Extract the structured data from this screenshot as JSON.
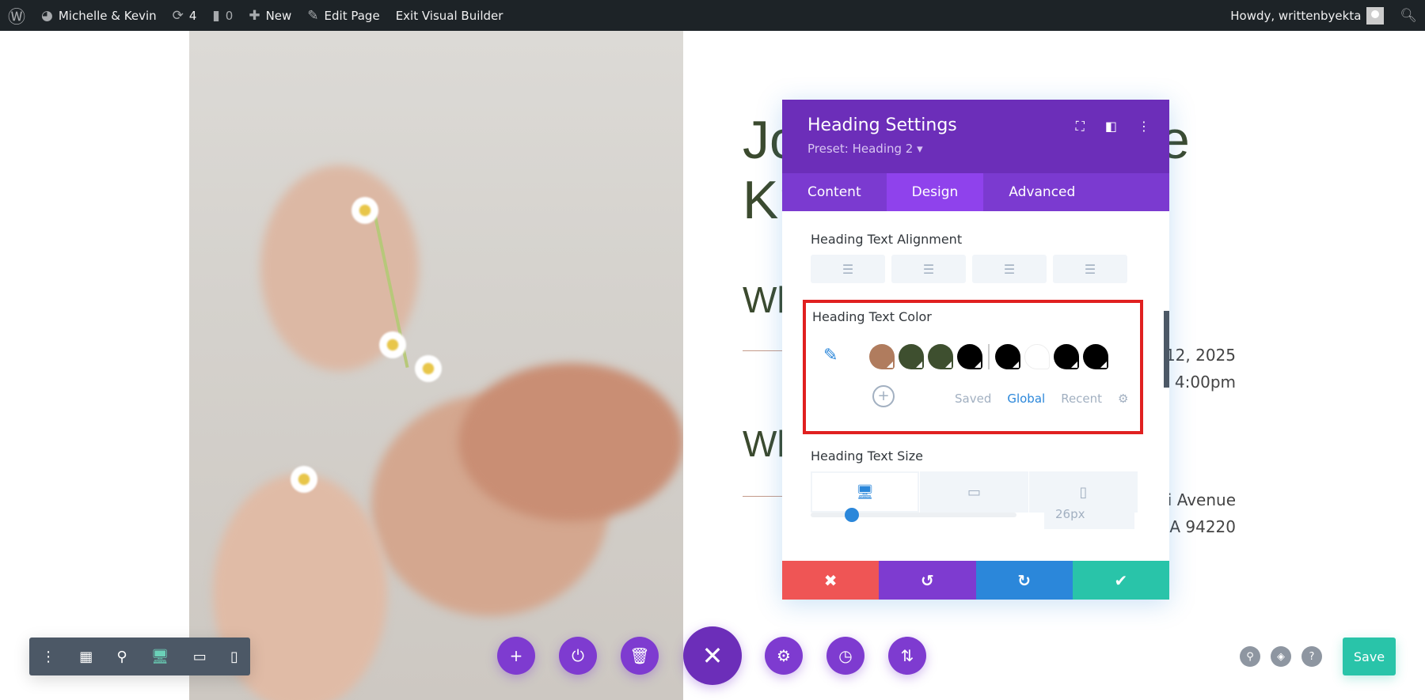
{
  "adminbar": {
    "site": "Michelle & Kevin",
    "updates": "4",
    "comments": "0",
    "new": "New",
    "edit": "Edit Page",
    "exit": "Exit Visual Builder",
    "howdy": "Howdy, writtenbyekta"
  },
  "page": {
    "heading_line1_left": "Jo",
    "heading_line1_right": "e",
    "heading_line2": "Kr",
    "section1": "Wh",
    "date": "12, 2025",
    "time": "4:00pm",
    "section2": "Wh",
    "address1": "vi Avenue",
    "address2": "CA 94220"
  },
  "panel": {
    "title": "Heading Settings",
    "preset": "Preset: Heading 2 ▾",
    "tabs": [
      "Content",
      "Design",
      "Advanced"
    ],
    "active_tab": "Design",
    "alignment_label": "Heading Text Alignment",
    "color_label": "Heading Text Color",
    "swatches": [
      "#b07c5e",
      "#3e4f2f",
      "#3e4f2f",
      "#000000",
      "#000000",
      "#ffffff",
      "#000000",
      "#000000"
    ],
    "color_tabs": [
      "Saved",
      "Global",
      "Recent"
    ],
    "active_color_tab": "Global",
    "size_label": "Heading Text Size",
    "size_value": "26px",
    "size_slider_fraction": 0.1
  },
  "toolbar": {
    "save": "Save"
  },
  "colors": {
    "purple": "#6c2eb9",
    "tab": "#7b3ad0",
    "tab_active": "#8f42ec",
    "cancel": "#ef5555",
    "undo": "#7e3bd0",
    "redo": "#2b87da",
    "confirm": "#29c4a9",
    "heading": "#3b4a2e"
  }
}
